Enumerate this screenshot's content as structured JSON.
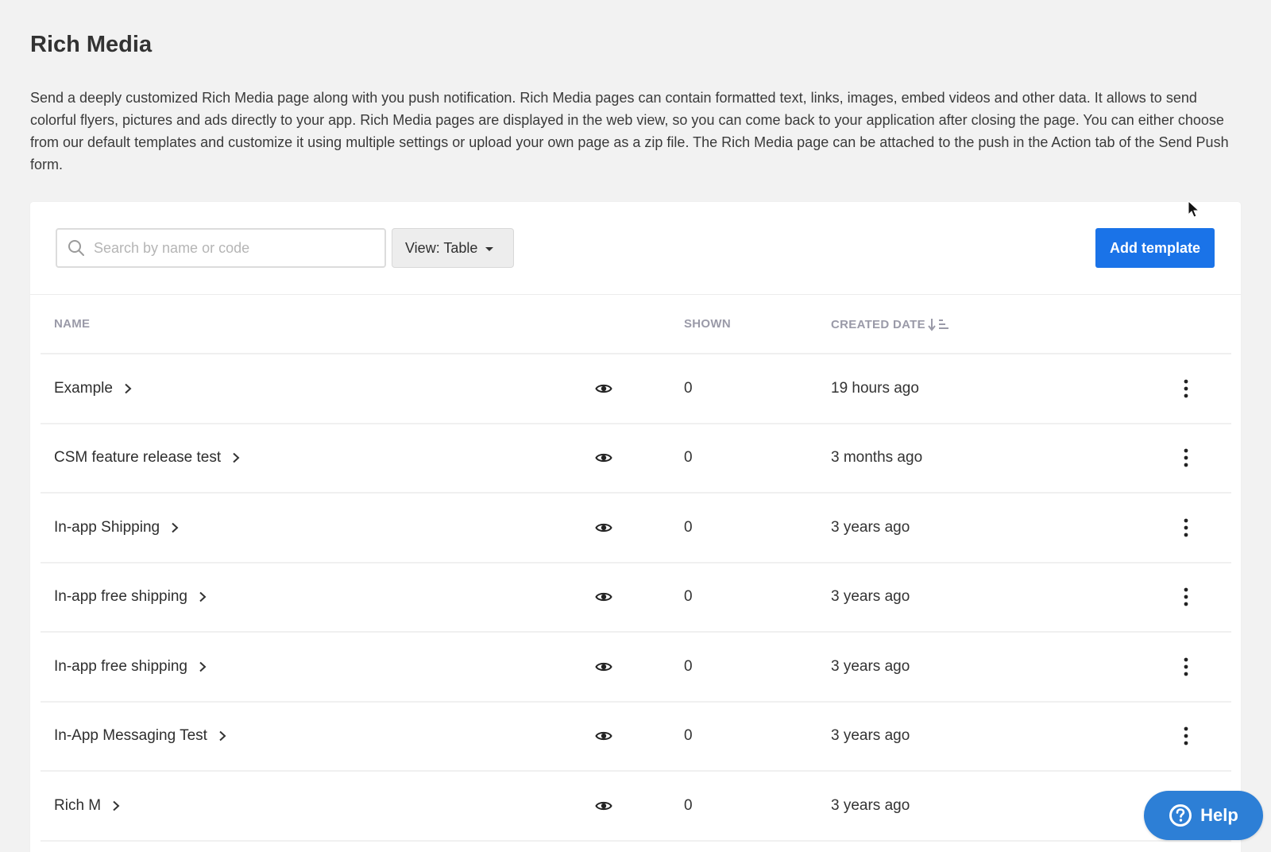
{
  "page": {
    "title": "Rich Media",
    "description": "Send a deeply customized Rich Media page along with you push notification. Rich Media pages can contain formatted text, links, images, embed videos and other data. It allows to send colorful flyers, pictures and ads directly to your app. Rich Media pages are displayed in the web view, so you can come back to your application after closing the page. You can either choose from our default templates and customize it using multiple settings or upload your own page as a zip file. The Rich Media page can be attached to the push in the Action tab of the Send Push form."
  },
  "toolbar": {
    "search_placeholder": "Search by name or code",
    "search_value": "",
    "view_label": "View: Table",
    "add_label": "Add template"
  },
  "table": {
    "headers": {
      "name": "NAME",
      "shown": "SHOWN",
      "created": "CREATED DATE"
    },
    "rows": [
      {
        "name": "Example",
        "shown": "0",
        "created": "19 hours ago"
      },
      {
        "name": "CSM feature release test",
        "shown": "0",
        "created": "3 months ago"
      },
      {
        "name": "In-app Shipping",
        "shown": "0",
        "created": "3 years ago"
      },
      {
        "name": "In-app free shipping",
        "shown": "0",
        "created": "3 years ago"
      },
      {
        "name": "In-app free shipping",
        "shown": "0",
        "created": "3 years ago"
      },
      {
        "name": "In-App Messaging Test",
        "shown": "0",
        "created": "3 years ago"
      },
      {
        "name": "Rich M",
        "shown": "0",
        "created": "3 years ago"
      }
    ]
  },
  "help": {
    "label": "Help"
  },
  "colors": {
    "accent": "#1a73e8",
    "help": "#2d7fd6",
    "background": "#f2f2f2",
    "header_text": "#9a9aa8"
  }
}
